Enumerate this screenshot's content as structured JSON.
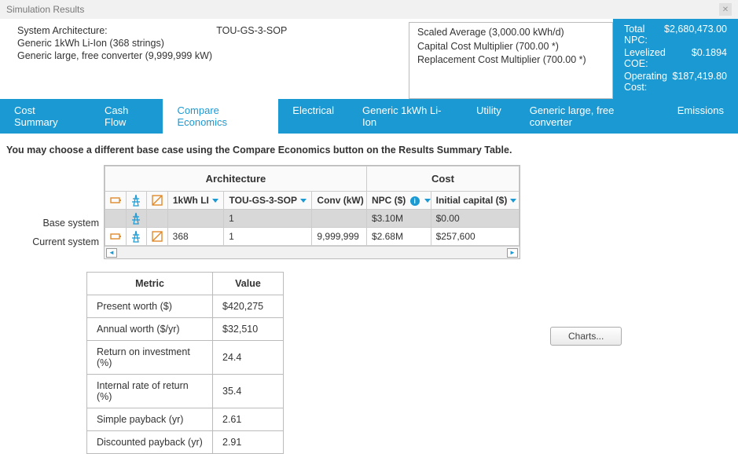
{
  "window": {
    "title": "Simulation Results"
  },
  "arch_info": {
    "label": "System Architecture:",
    "tariff": "TOU-GS-3-SOP",
    "line2": "Generic 1kWh Li-Ion (368 strings)",
    "line3": "Generic large, free converter (9,999,999 kW)"
  },
  "sensitivity": {
    "line1": "Scaled Average (3,000.00 kWh/d)",
    "line2": "Capital Cost Multiplier (700.00 *)",
    "line3": "Replacement Cost Multiplier (700.00 *)"
  },
  "totals": {
    "npc_label": "Total NPC:",
    "npc": "$2,680,473.00",
    "coe_label": "Levelized COE:",
    "coe": "$0.1894",
    "op_label": "Operating Cost:",
    "op": "$187,419.80"
  },
  "tabs": [
    "Cost Summary",
    "Cash Flow",
    "Compare Economics",
    "Electrical",
    "Generic 1kWh Li-Ion",
    "Utility",
    "Generic large, free converter",
    "Emissions"
  ],
  "active_tab": 2,
  "instruction": "You may choose a different base case using the Compare Economics button on the Results Summary Table.",
  "grid": {
    "group_arch": "Architecture",
    "group_cost": "Cost",
    "hdr_li": "1kWh LI",
    "hdr_tou": "TOU-GS-3-SOP",
    "hdr_conv": "Conv (kW)",
    "hdr_npc": "NPC ($)",
    "hdr_cap": "Initial capital ($)",
    "row_labels": {
      "base": "Base system",
      "current": "Current system"
    },
    "base": {
      "li": "",
      "tou": "1",
      "conv": "",
      "npc": "$3.10M",
      "cap": "$0.00"
    },
    "current": {
      "li": "368",
      "tou": "1",
      "conv": "9,999,999",
      "npc": "$2.68M",
      "cap": "$257,600"
    }
  },
  "metrics": {
    "hdr_metric": "Metric",
    "hdr_value": "Value",
    "rows": [
      {
        "m": "Present worth ($)",
        "v": "$420,275"
      },
      {
        "m": "Annual worth ($/yr)",
        "v": "$32,510"
      },
      {
        "m": "Return on investment (%)",
        "v": "24.4"
      },
      {
        "m": "Internal rate of return (%)",
        "v": "35.4"
      },
      {
        "m": "Simple payback (yr)",
        "v": "2.61"
      },
      {
        "m": "Discounted payback (yr)",
        "v": "2.91"
      }
    ]
  },
  "charts_btn": "Charts..."
}
